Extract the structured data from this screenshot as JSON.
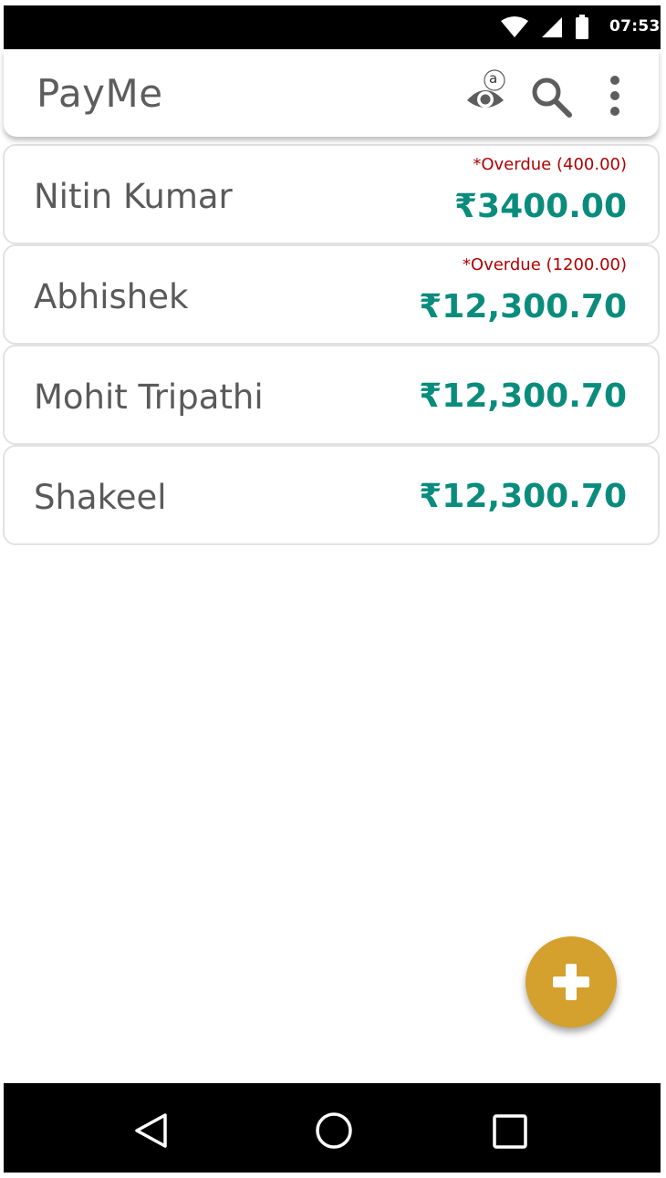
{
  "status_bar": {
    "time": "07:53",
    "icons": [
      "wifi-icon",
      "cell-signal-icon",
      "battery-icon"
    ]
  },
  "app_bar": {
    "title": "PayMe",
    "eye_badge": "a",
    "actions": [
      "eye-icon",
      "search-icon",
      "more-vert-icon"
    ]
  },
  "list": {
    "items": [
      {
        "name": "Nitin Kumar",
        "overdue": "*Overdue (400.00)",
        "amount": "₹3400.00"
      },
      {
        "name": "Abhishek",
        "overdue": "*Overdue (1200.00)",
        "amount": "₹12,300.70"
      },
      {
        "name": "Mohit Tripathi",
        "overdue": "",
        "amount": "₹12,300.70"
      },
      {
        "name": "Shakeel",
        "overdue": "",
        "amount": "₹12,300.70"
      }
    ]
  },
  "fab": {
    "icon": "plus-icon"
  },
  "nav_bar": {
    "icons": [
      "back-icon",
      "home-icon",
      "recent-apps-icon"
    ]
  },
  "colors": {
    "accent": "#d4a02e",
    "amount": "#0a8c7c",
    "overdue": "#b00000",
    "text": "#5a5a5a"
  }
}
